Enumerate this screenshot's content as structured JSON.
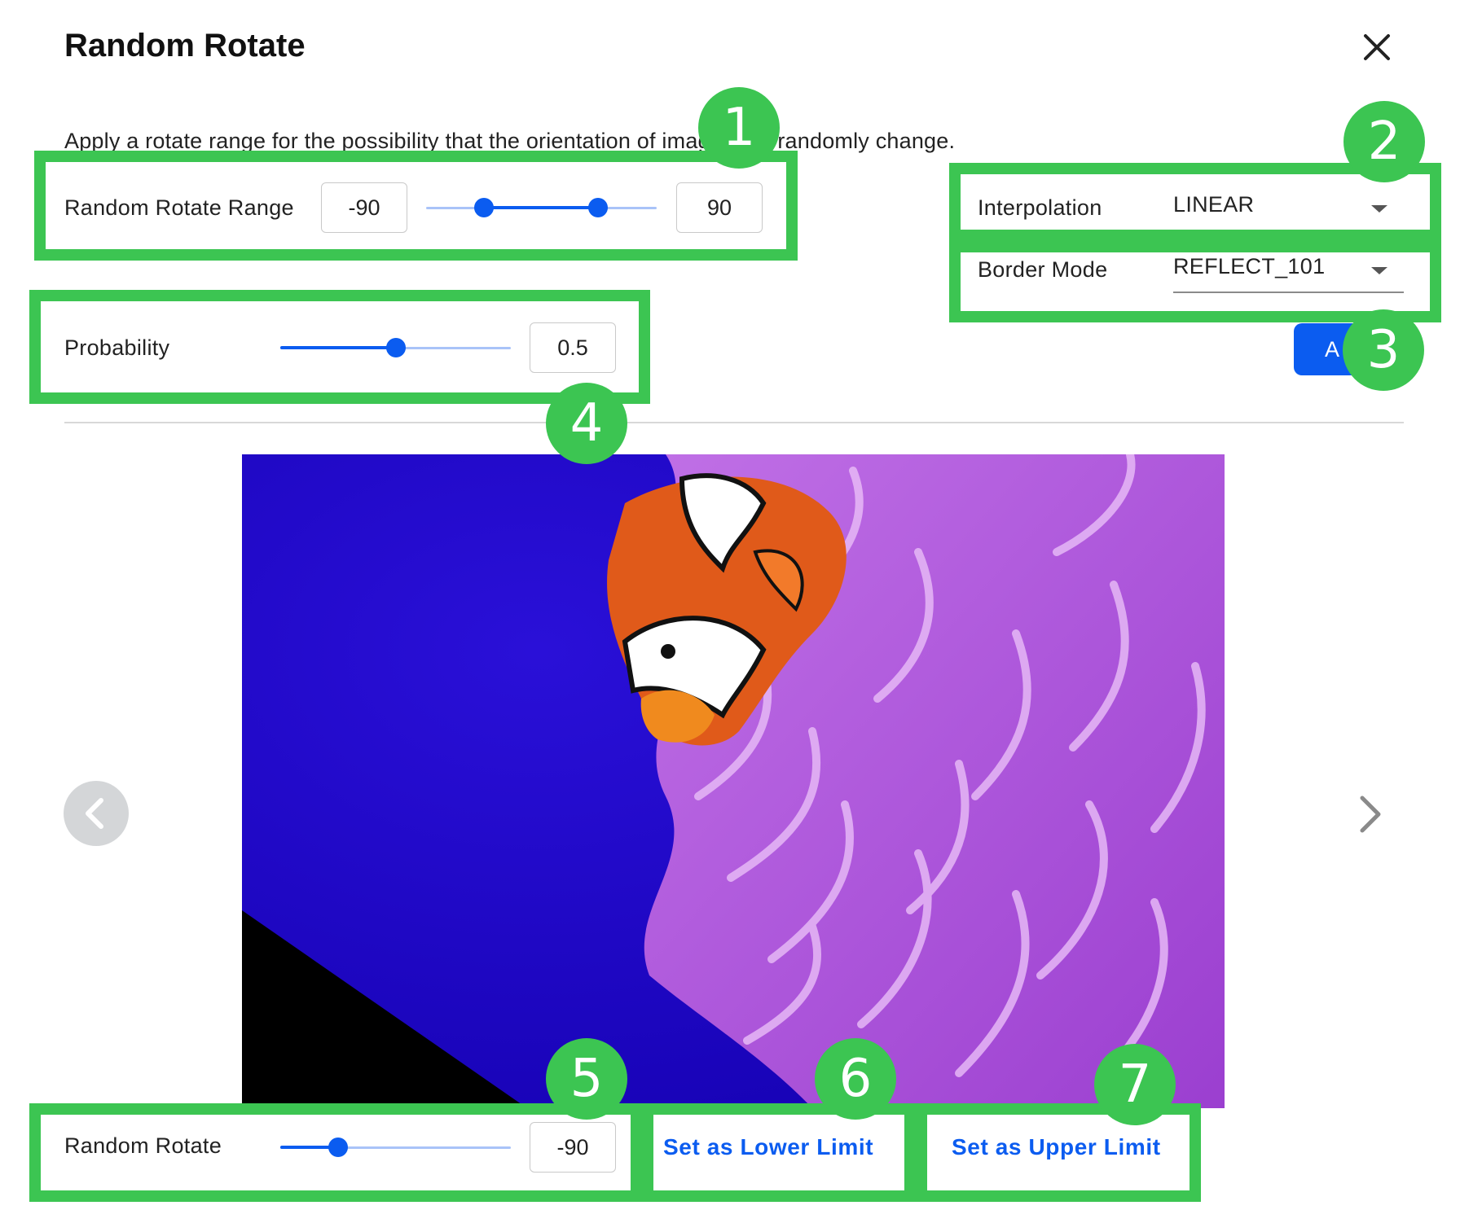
{
  "dialog": {
    "title": "Random Rotate",
    "description": "Apply a rotate range for the possibility that the orientation of images will randomly change."
  },
  "rotate_range": {
    "label": "Random Rotate Range",
    "min_value": "-90",
    "max_value": "90"
  },
  "interpolation": {
    "label": "Interpolation",
    "value": "LINEAR"
  },
  "border_mode": {
    "label": "Border Mode",
    "value": "REFLECT_101"
  },
  "apply_button": {
    "label": "A"
  },
  "probability": {
    "label": "Probability",
    "value": "0.5"
  },
  "preview": {
    "random_rotate_label": "Random Rotate",
    "random_rotate_value": "-90",
    "set_lower_label": "Set as Lower Limit",
    "set_upper_label": "Set as Upper Limit"
  },
  "badges": [
    "1",
    "2",
    "3",
    "4",
    "5",
    "6",
    "7"
  ],
  "colors": {
    "accent": "#0b5cf0",
    "highlight": "#3cc552",
    "track_light": "#a9c3f8"
  }
}
